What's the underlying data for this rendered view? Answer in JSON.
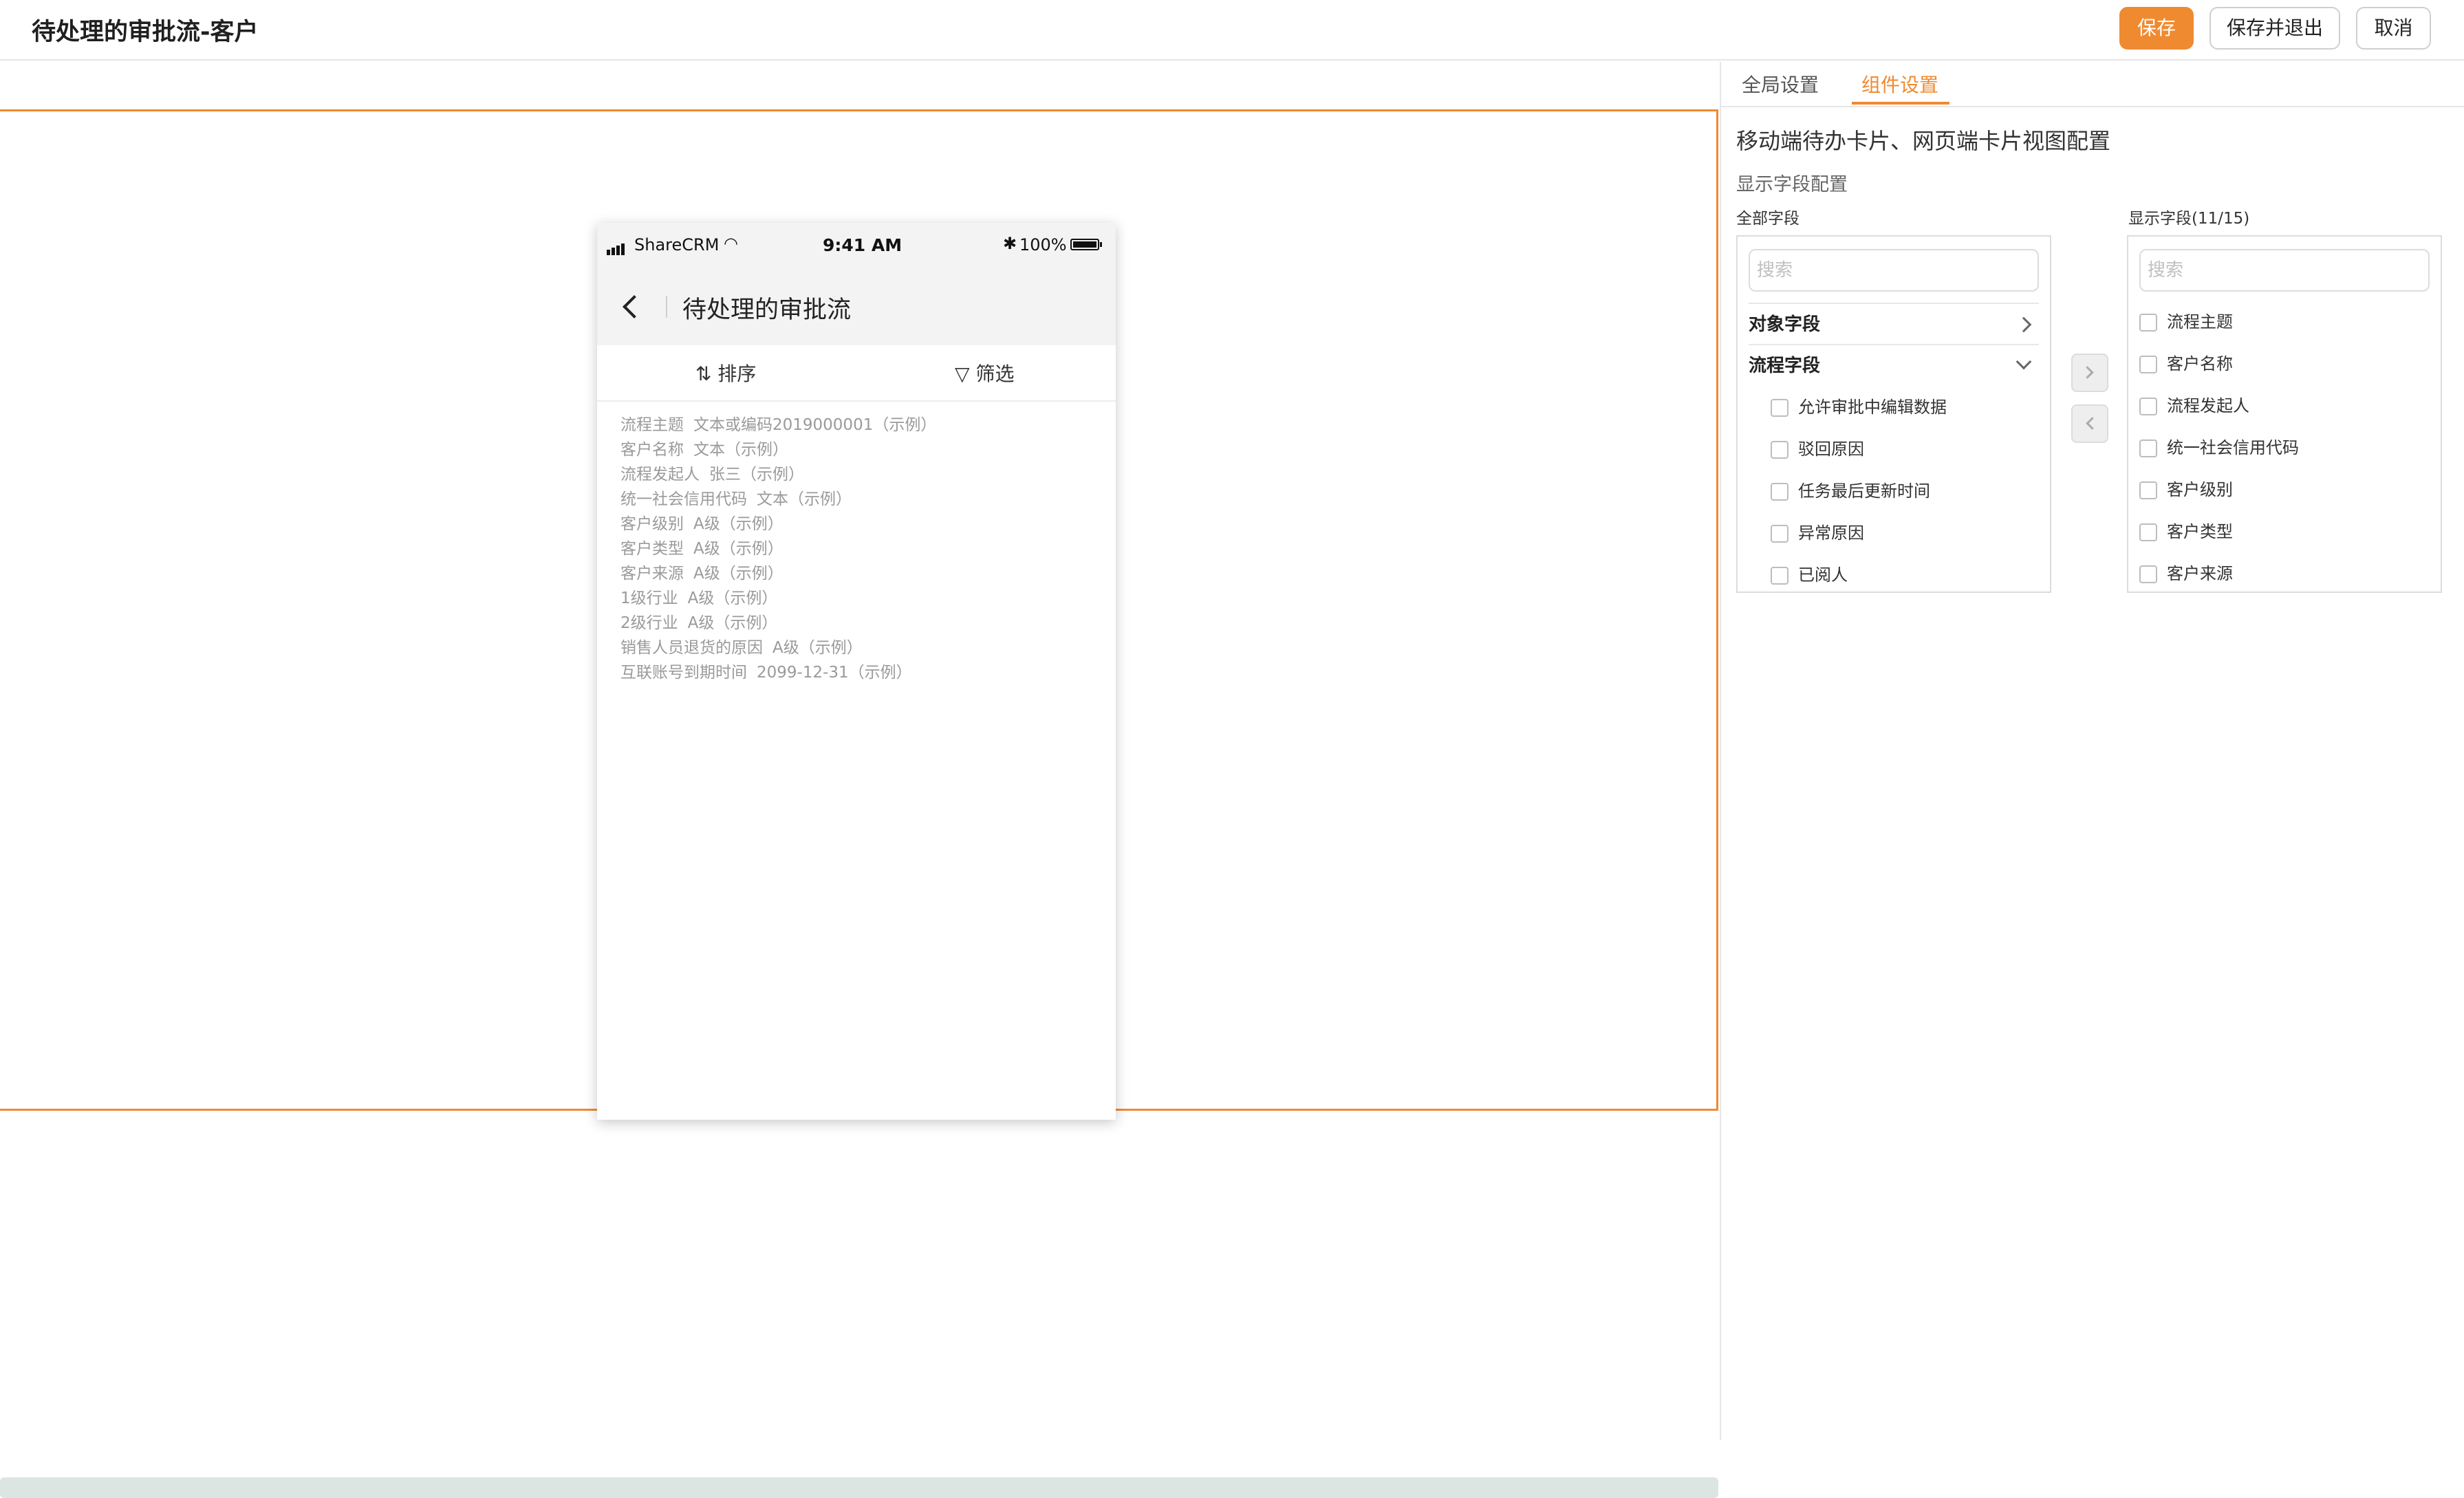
{
  "header": {
    "title": "待处理的审批流-客户",
    "save_label": "保存",
    "save_exit_label": "保存并退出",
    "cancel_label": "取消"
  },
  "phone": {
    "carrier": "ShareCRM",
    "time": "9:41 AM",
    "battery": "100%",
    "nav_title": "待处理的审批流",
    "sort_label": "排序",
    "filter_label": "筛选",
    "card_fields": [
      {
        "label": "流程主题",
        "value": "文本或编码2019000001（示例）"
      },
      {
        "label": "客户名称",
        "value": "文本（示例）"
      },
      {
        "label": "流程发起人",
        "value": "张三（示例）"
      },
      {
        "label": "统一社会信用代码",
        "value": "文本（示例）"
      },
      {
        "label": "客户级别",
        "value": "A级（示例）"
      },
      {
        "label": "客户类型",
        "value": "A级（示例）"
      },
      {
        "label": "客户来源",
        "value": "A级（示例）"
      },
      {
        "label": "1级行业",
        "value": "A级（示例）"
      },
      {
        "label": "2级行业",
        "value": "A级（示例）"
      },
      {
        "label": "销售人员退货的原因",
        "value": "A级（示例）"
      },
      {
        "label": "互联账号到期时间",
        "value": "2099-12-31（示例）"
      }
    ]
  },
  "panel": {
    "tabs": [
      {
        "label": "全局设置",
        "active": false
      },
      {
        "label": "组件设置",
        "active": true
      }
    ],
    "section_title": "移动端待办卡片、网页端卡片视图配置",
    "sub_title": "显示字段配置",
    "all_fields_label": "全部字段",
    "shown_fields_label": "显示字段(11/15)",
    "search_placeholder": "搜索",
    "groups": [
      {
        "label": "对象字段",
        "expanded": false
      },
      {
        "label": "流程字段",
        "expanded": true
      }
    ],
    "process_fields": [
      "允许审批中编辑数据",
      "驳回原因",
      "任务最后更新时间",
      "异常原因",
      "已阅人"
    ],
    "shown_fields": [
      "流程主题",
      "客户名称",
      "流程发起人",
      "统一社会信用代码",
      "客户级别",
      "客户类型",
      "客户来源"
    ]
  },
  "colors": {
    "accent": "#f08a30",
    "border": "#dcdcdc",
    "muted_text": "#9a9a9a"
  },
  "icons": [
    "back-icon",
    "wifi-icon",
    "bluetooth-icon",
    "battery-icon",
    "sort-icon",
    "filter-icon",
    "chevron-right-icon",
    "chevron-down-icon"
  ]
}
